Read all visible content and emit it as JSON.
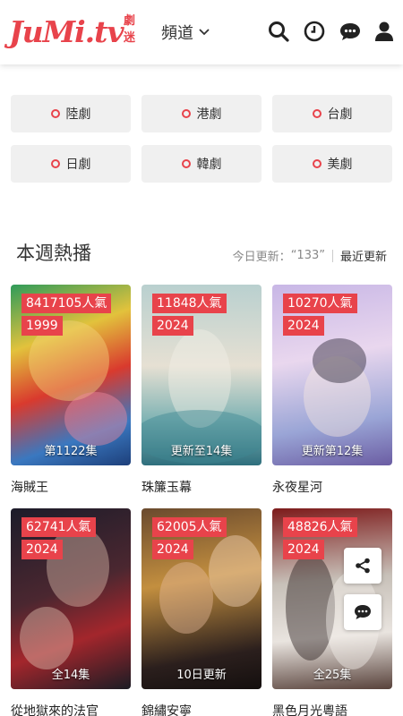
{
  "header": {
    "logo_text": "JuMi.tv",
    "logo_tag": "劇迷",
    "channel_label": "頻道"
  },
  "categories": [
    {
      "label": "陸劇"
    },
    {
      "label": "港劇"
    },
    {
      "label": "台劇"
    },
    {
      "label": "日劇"
    },
    {
      "label": "韓劇"
    },
    {
      "label": "美劇"
    }
  ],
  "section": {
    "title": "本週熱播",
    "update_label": "今日更新：",
    "update_count": "“133”",
    "recent_label": "最近更新"
  },
  "cards": [
    {
      "views": "8417105人氣",
      "year": "1999",
      "episode": "第1122集",
      "title": "海賊王"
    },
    {
      "views": "11848人氣",
      "year": "2024",
      "episode": "更新至14集",
      "title": "珠簾玉幕"
    },
    {
      "views": "10270人氣",
      "year": "2024",
      "episode": "更新第12集",
      "title": "永夜星河"
    },
    {
      "views": "62741人氣",
      "year": "2024",
      "episode": "全14集",
      "title": "從地獄來的法官"
    },
    {
      "views": "62005人氣",
      "year": "2024",
      "episode": "10日更新",
      "title": "錦繡安寧"
    },
    {
      "views": "48826人氣",
      "year": "2024",
      "episode": "全25集",
      "title": "黑色月光粵語"
    }
  ],
  "colors": {
    "accent": "#e8434b",
    "chip_bg": "#f0f0f0"
  },
  "icons": [
    "search-icon",
    "history-icon",
    "chat-icon",
    "user-icon",
    "share-icon",
    "comment-icon",
    "chevron-down-icon"
  ]
}
